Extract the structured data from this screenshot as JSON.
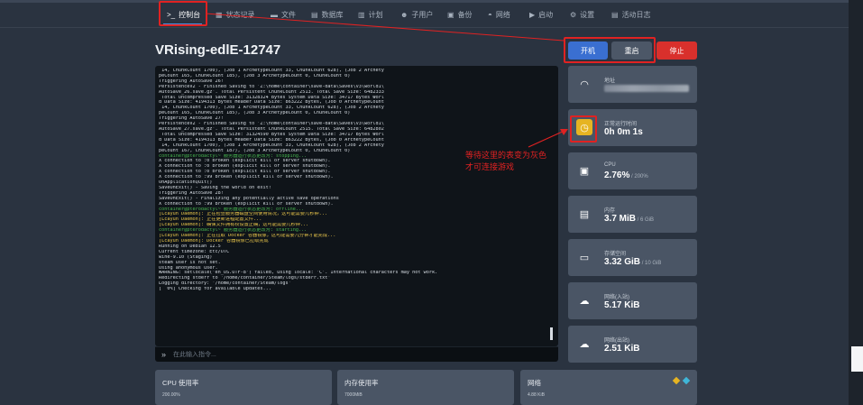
{
  "nav": {
    "tabs": [
      {
        "label": "控制台",
        "icon": "terminal-icon",
        "glyph": ">_",
        "active": true
      },
      {
        "label": "状态记录",
        "icon": "chart-icon",
        "glyph": "▦"
      },
      {
        "label": "文件",
        "icon": "folder-icon",
        "glyph": "▬"
      },
      {
        "label": "数据库",
        "icon": "database-icon",
        "glyph": "▤"
      },
      {
        "label": "计划",
        "icon": "calendar-icon",
        "glyph": "▥"
      },
      {
        "label": "子用户",
        "icon": "users-icon",
        "glyph": "☻"
      },
      {
        "label": "备份",
        "icon": "archive-icon",
        "glyph": "▣"
      },
      {
        "label": "网络",
        "icon": "network-icon",
        "glyph": "◓"
      },
      {
        "label": "启动",
        "icon": "play-icon",
        "glyph": "▶"
      },
      {
        "label": "设置",
        "icon": "settings-icon",
        "glyph": "⚙"
      },
      {
        "label": "活动日志",
        "icon": "log-icon",
        "glyph": "▤"
      }
    ]
  },
  "server": {
    "title": "VRising-edlE-12747"
  },
  "power": {
    "start": "开机",
    "restart": "重启",
    "stop": "停止"
  },
  "console": {
    "lines": [
      {
        "t": " 14, ChunkCount 1700), (Job 1 ArchetypeCount 33, ChunkCount 628), (Job 2 Archety",
        "c": ""
      },
      {
        "t": "peCount 165, ChunkCount 185), (Job 3 ArchetypeCount 0, ChunkCount 0)",
        "c": ""
      },
      {
        "t": "Triggering AutoSave 26!",
        "c": ""
      },
      {
        "t": "PersistenceV2 - Finished Saving to 'Z:\\home\\container\\save-data\\Saves\\v3\\world1\\",
        "c": ""
      },
      {
        "t": "AutoSave_26.save.gz'. Total Persistent ChunkCount 2513. Total Save Size: 6482333",
        "c": ""
      },
      {
        "t": " Total Uncompressed Save Size: 31328324 Bytes System Data Size: 34717 Bytes Worl",
        "c": ""
      },
      {
        "t": "d Data Size: 4194313 Bytes Header Data Size: 863222 Bytes, (Job 0 ArchetypeCount",
        "c": ""
      },
      {
        "t": " 14, ChunkCount 1700), (Job 1 ArchetypeCount 33, ChunkCount 628), (Job 2 Archety",
        "c": ""
      },
      {
        "t": "peCount 165, ChunkCount 185), (Job 3 ArchetypeCount 0, ChunkCount 0)",
        "c": ""
      },
      {
        "t": "Triggering AutoSave 27!",
        "c": ""
      },
      {
        "t": "PersistenceV2 - Finished Saving to 'Z:\\home\\container\\save-data\\Saves\\v3\\world1\\",
        "c": ""
      },
      {
        "t": "AutoSave_27.save.gz'. Total Persistent ChunkCount 2515. Total Save Size: 6482802",
        "c": ""
      },
      {
        "t": " Total Uncompressed Save Size: 31324590 Bytes System Data Size: 34717 Bytes Worl",
        "c": ""
      },
      {
        "t": "d Data Size: 4194313 Bytes Header Data Size: 863222 Bytes, (Job 0 ArchetypeCount",
        "c": ""
      },
      {
        "t": " 14, ChunkCount 1700), (Job 1 ArchetypeCount 33, ChunkCount 628), (Job 2 Archety",
        "c": ""
      },
      {
        "t": "peCount 167, ChunkCount 187), (Job 3 ArchetypeCount 0, ChunkCount 0)",
        "c": ""
      },
      {
        "t": "container@pterodactyl~ 服务器运行状态更改为: stopping...",
        "c": "green"
      },
      {
        "t": "X connection to :0 broken (explicit kill or server shutdown).",
        "c": ""
      },
      {
        "t": "X connection to :0 broken (explicit kill or server shutdown).",
        "c": ""
      },
      {
        "t": "X connection to :0 broken (explicit kill or server shutdown).",
        "c": ""
      },
      {
        "t": "X connection to :99 broken (explicit kill or server shutdown).",
        "c": ""
      },
      {
        "t": "OnApplicationQuit()",
        "c": ""
      },
      {
        "t": "SaveOnExit() - Saving the world on exit!",
        "c": ""
      },
      {
        "t": "Triggering AutoSave 28!",
        "c": ""
      },
      {
        "t": "SaveOnExit() - Finalizing any potentially active save operations",
        "c": ""
      },
      {
        "t": "X connection to :99 broken (explicit kill or server shutdown).",
        "c": ""
      },
      {
        "t": "container@pterodactyl~ 服务器运行状态更改为: offline...",
        "c": "green"
      },
      {
        "t": "[Lcayun Daemon]: 正在检查服务器磁盘空间使用情况，这可能需要几秒钟...",
        "c": "yellow"
      },
      {
        "t": "[Lcayun Daemon]: 正在更新进程配置文件...",
        "c": "yellow"
      },
      {
        "t": "[Lcayun Daemon]: 确保文件拥有权设置正确，这可能需要几秒钟...",
        "c": "yellow"
      },
      {
        "t": "container@pterodactyl~ 服务器运行状态更改为: starting...",
        "c": "green"
      },
      {
        "t": "[Lcayun Daemon]: 正在拉取 Docker 容器镜像，这可能需要几分钟才能完成...",
        "c": "yellow"
      },
      {
        "t": "[Lcayun Daemon]: Docker 容器镜像已拉取完成",
        "c": "yellow"
      },
      {
        "t": "Running on Debian 12.5",
        "c": ""
      },
      {
        "t": "Current timezone: Etc/UTC",
        "c": ""
      },
      {
        "t": "wine-9.10 (Staging)",
        "c": ""
      },
      {
        "t": "steam user is not set.",
        "c": ""
      },
      {
        "t": "Using anonymous user.",
        "c": ""
      },
      {
        "t": "WARNING: setlocale('en_US.UTF-8') failed, using locale: 'C'. International characters may not work.",
        "c": ""
      },
      {
        "t": "Redirecting stderr to '/home/container/Steam/logs/stderr.txt'",
        "c": ""
      },
      {
        "t": "Logging directory: '/home/container/Steam/logs'",
        "c": ""
      },
      {
        "t": "[  0%] Checking for available updates...",
        "c": ""
      }
    ],
    "prompt_glyph": "»",
    "input_placeholder": "在此输入指令..."
  },
  "stats": {
    "address": {
      "label": "地址",
      "icon": "wifi-icon",
      "glyph": "◠"
    },
    "uptime": {
      "label": "正常运行时间",
      "value": "0h 0m 1s",
      "icon": "clock-icon",
      "glyph": "◷"
    },
    "cpu": {
      "label": "CPU",
      "value": "2.76%",
      "limit": " / 200%",
      "icon": "cpu-icon",
      "glyph": "▣"
    },
    "memory": {
      "label": "内存",
      "value": "3.7 MiB",
      "limit": " / 6 GiB",
      "icon": "memory-icon",
      "glyph": "▤"
    },
    "disk": {
      "label": "存储空间",
      "value": "3.32 GiB",
      "limit": " / 10 GiB",
      "icon": "hdd-icon",
      "glyph": "▭"
    },
    "net_in": {
      "label": "网络(入站)",
      "value": "5.17 KiB",
      "icon": "cloud-download-icon",
      "glyph": "☁"
    },
    "net_out": {
      "label": "网络(出站)",
      "value": "2.51 KiB",
      "icon": "cloud-upload-icon",
      "glyph": "☁"
    }
  },
  "annotation": {
    "line1": "等待这里的表变为灰色",
    "line2": "才可连接游戏",
    "color": "#e02222"
  },
  "graphs": {
    "cpu": {
      "title": "CPU 使用率",
      "sub": "200.00%"
    },
    "memory": {
      "title": "内存使用率",
      "sub": "7000MiB"
    },
    "network": {
      "title": "网络",
      "sub": "4.88 KiB",
      "legend_colors": [
        "#e6b422",
        "#3fb6d8"
      ]
    }
  }
}
